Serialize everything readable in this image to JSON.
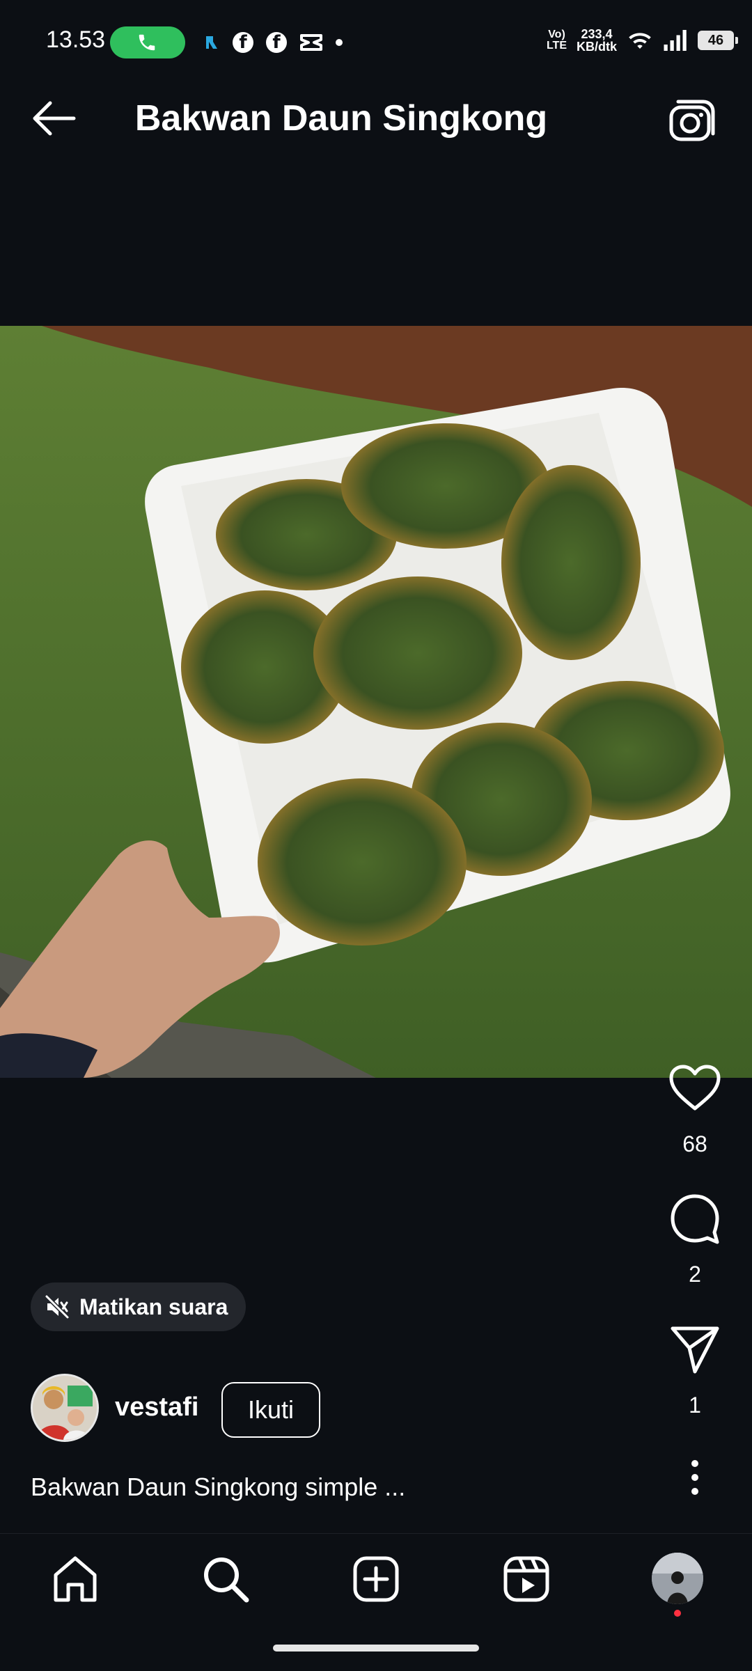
{
  "status_bar": {
    "time": "13.53",
    "volte_line1": "Vo)",
    "volte_line2": "LTE",
    "speed_line1": "233,4",
    "speed_line2": "KB/dtk",
    "battery": "46"
  },
  "header": {
    "title": "Bakwan Daun Singkong"
  },
  "actions": {
    "likes": "68",
    "comments": "2",
    "shares": "1"
  },
  "mute": {
    "label": "Matikan suara"
  },
  "author": {
    "username": "vestafi",
    "follow_label": "Ikuti"
  },
  "caption": "Bakwan Daun Singkong simple ...",
  "colors": {
    "background": "#0c0f14",
    "call_green": "#2fbf5d",
    "notification_dot": "#ff3040"
  }
}
